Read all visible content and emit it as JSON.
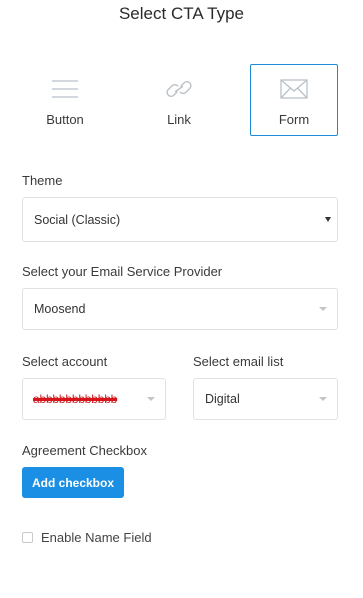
{
  "title": "Select CTA Type",
  "cta_types": [
    {
      "label": "Button",
      "icon": "hamburger-lines-icon",
      "active": false
    },
    {
      "label": "Link",
      "icon": "chain-link-icon",
      "active": false
    },
    {
      "label": "Form",
      "icon": "envelope-icon",
      "active": true
    }
  ],
  "colors": {
    "accent": "#1a8cd8",
    "button_bg": "#1b8fe3",
    "redaction": "#d8131a"
  },
  "theme": {
    "label": "Theme",
    "value": "Social (Classic)"
  },
  "provider": {
    "label": "Select your Email Service Provider",
    "value": "Moosend"
  },
  "account": {
    "label": "Select account",
    "value_redacted": "abbbbbbbbbbbb"
  },
  "email_list": {
    "label": "Select email list",
    "value": "Digital"
  },
  "agreement": {
    "label": "Agreement Checkbox",
    "button_label": "Add checkbox"
  },
  "name_field": {
    "label": "Enable Name Field",
    "checked": false
  }
}
